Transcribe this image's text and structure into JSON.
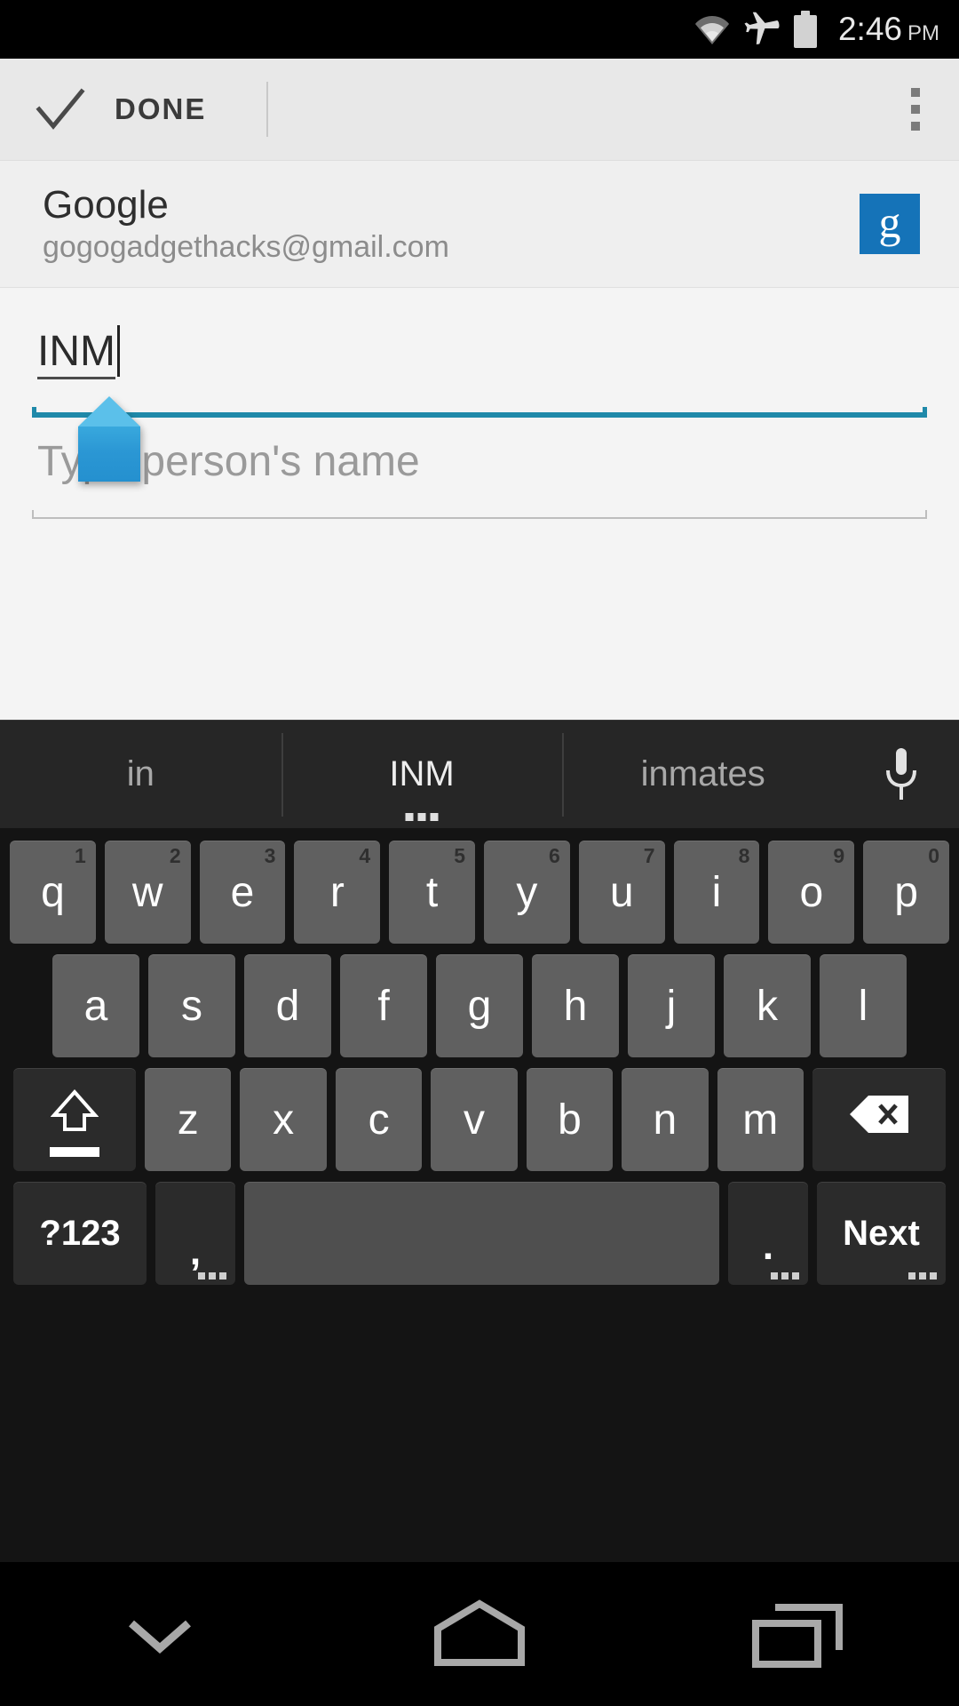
{
  "status_bar": {
    "wifi_icon": "wifi-icon",
    "airplane_icon": "airplane-mode-icon",
    "battery_icon": "battery-icon",
    "time": "2:46",
    "am_pm": "PM"
  },
  "action_bar": {
    "check_icon": "check-icon",
    "done_label": "DONE",
    "overflow_icon": "overflow-menu-icon"
  },
  "account": {
    "provider": "Google",
    "email": "gogogadgethacks@gmail.com",
    "badge_letter": "g",
    "badge_color": "#1573b8"
  },
  "form": {
    "name_field": {
      "value": "INM",
      "underline_color": "#1f89a9"
    },
    "person_field": {
      "placeholder": "Type person's name",
      "value": "",
      "underline_color": "#bdbdbd"
    },
    "selection_handle": "text-selection-handle"
  },
  "keyboard": {
    "suggestions": [
      {
        "label": "in",
        "active": false,
        "has_dots": false
      },
      {
        "label": "INM",
        "active": true,
        "has_dots": true
      },
      {
        "label": "inmates",
        "active": false,
        "has_dots": false
      }
    ],
    "mic_icon": "microphone-icon",
    "row1": [
      {
        "label": "q",
        "num": "1"
      },
      {
        "label": "w",
        "num": "2"
      },
      {
        "label": "e",
        "num": "3"
      },
      {
        "label": "r",
        "num": "4"
      },
      {
        "label": "t",
        "num": "5"
      },
      {
        "label": "y",
        "num": "6"
      },
      {
        "label": "u",
        "num": "7"
      },
      {
        "label": "i",
        "num": "8"
      },
      {
        "label": "o",
        "num": "9"
      },
      {
        "label": "p",
        "num": "0"
      }
    ],
    "row2": [
      {
        "label": "a"
      },
      {
        "label": "s"
      },
      {
        "label": "d"
      },
      {
        "label": "f"
      },
      {
        "label": "g"
      },
      {
        "label": "h"
      },
      {
        "label": "j"
      },
      {
        "label": "k"
      },
      {
        "label": "l"
      }
    ],
    "row3": [
      {
        "label": "z"
      },
      {
        "label": "x"
      },
      {
        "label": "c"
      },
      {
        "label": "v"
      },
      {
        "label": "b"
      },
      {
        "label": "n"
      },
      {
        "label": "m"
      }
    ],
    "shift_icon": "shift-key-icon",
    "backspace_icon": "backspace-key-icon",
    "symbols_label": "?123",
    "comma_label": ",",
    "space_label": "",
    "period_label": ".",
    "next_label": "Next"
  },
  "nav_bar": {
    "back_icon": "hide-keyboard-down-icon",
    "home_icon": "home-icon",
    "recents_icon": "recent-apps-icon"
  }
}
